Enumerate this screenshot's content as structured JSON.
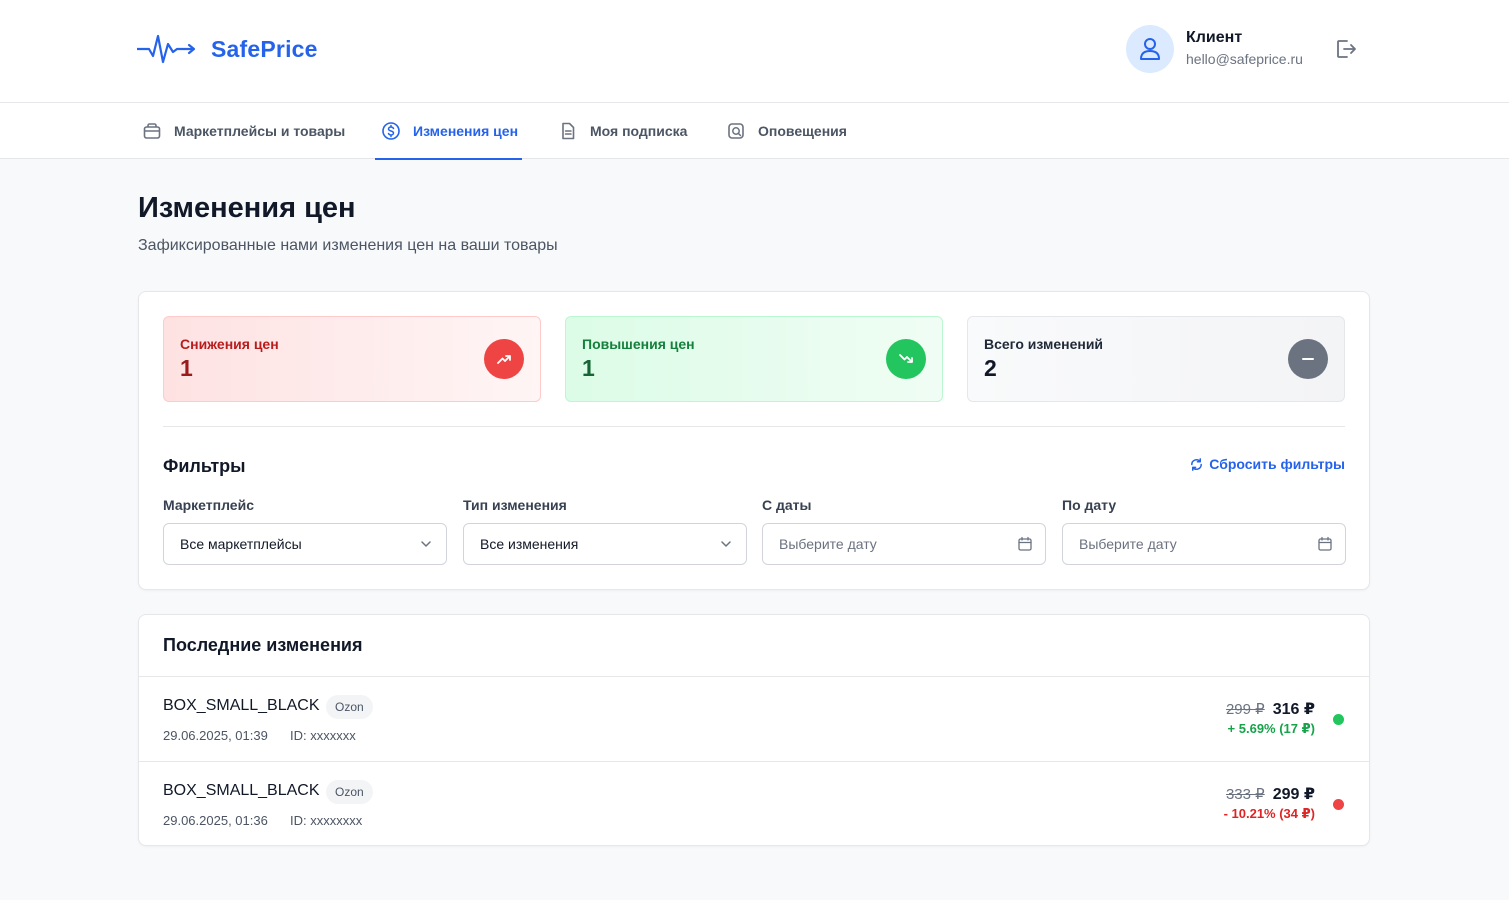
{
  "brand": {
    "name": "SafePrice",
    "accent": "#2563eb"
  },
  "user": {
    "name": "Клиент",
    "email": "hello@safeprice.ru"
  },
  "nav": {
    "tabs": [
      {
        "label": "Маркетплейсы и товары",
        "icon": "bag-icon",
        "active": false
      },
      {
        "label": "Изменения цен",
        "icon": "dollar-circle-icon",
        "active": true
      },
      {
        "label": "Моя подписка",
        "icon": "document-icon",
        "active": false
      },
      {
        "label": "Оповещения",
        "icon": "alert-icon",
        "active": false
      }
    ]
  },
  "page": {
    "title": "Изменения цен",
    "subtitle": "Зафиксированные нами изменения цен на ваши товары"
  },
  "stats": {
    "decreases": {
      "label": "Снижения цен",
      "value": "1",
      "icon": "trend-up-icon",
      "color": "#ef4444"
    },
    "increases": {
      "label": "Повышения цен",
      "value": "1",
      "icon": "trend-down-icon",
      "color": "#22c55e"
    },
    "total": {
      "label": "Всего изменений",
      "value": "2",
      "icon": "minus-icon",
      "color": "#6b7280"
    }
  },
  "filters": {
    "title": "Фильтры",
    "reset_label": "Сбросить фильтры",
    "marketplace": {
      "label": "Маркетплейс",
      "value": "Все маркетплейсы"
    },
    "change_type": {
      "label": "Тип изменения",
      "value": "Все изменения"
    },
    "date_from": {
      "label": "С даты",
      "placeholder": "Выберите дату"
    },
    "date_to": {
      "label": "По дату",
      "placeholder": "Выберите дату"
    }
  },
  "changes": {
    "title": "Последние изменения",
    "items": [
      {
        "name": "BOX_SMALL_BLACK",
        "marketplace": "Ozon",
        "datetime": "29.06.2025, 01:39",
        "id": "ID: xxxxxxx",
        "old_price": "299 ₽",
        "new_price": "316 ₽",
        "delta": "+ 5.69% (17 ₽)",
        "color": "#16a34a",
        "dot_color": "#22c55e"
      },
      {
        "name": "BOX_SMALL_BLACK",
        "marketplace": "Ozon",
        "datetime": "29.06.2025, 01:36",
        "id": "ID: xxxxxxxx",
        "old_price": "333 ₽",
        "new_price": "299 ₽",
        "delta": "- 10.21% (34 ₽)",
        "color": "#dc2626",
        "dot_color": "#ef4444"
      }
    ]
  }
}
